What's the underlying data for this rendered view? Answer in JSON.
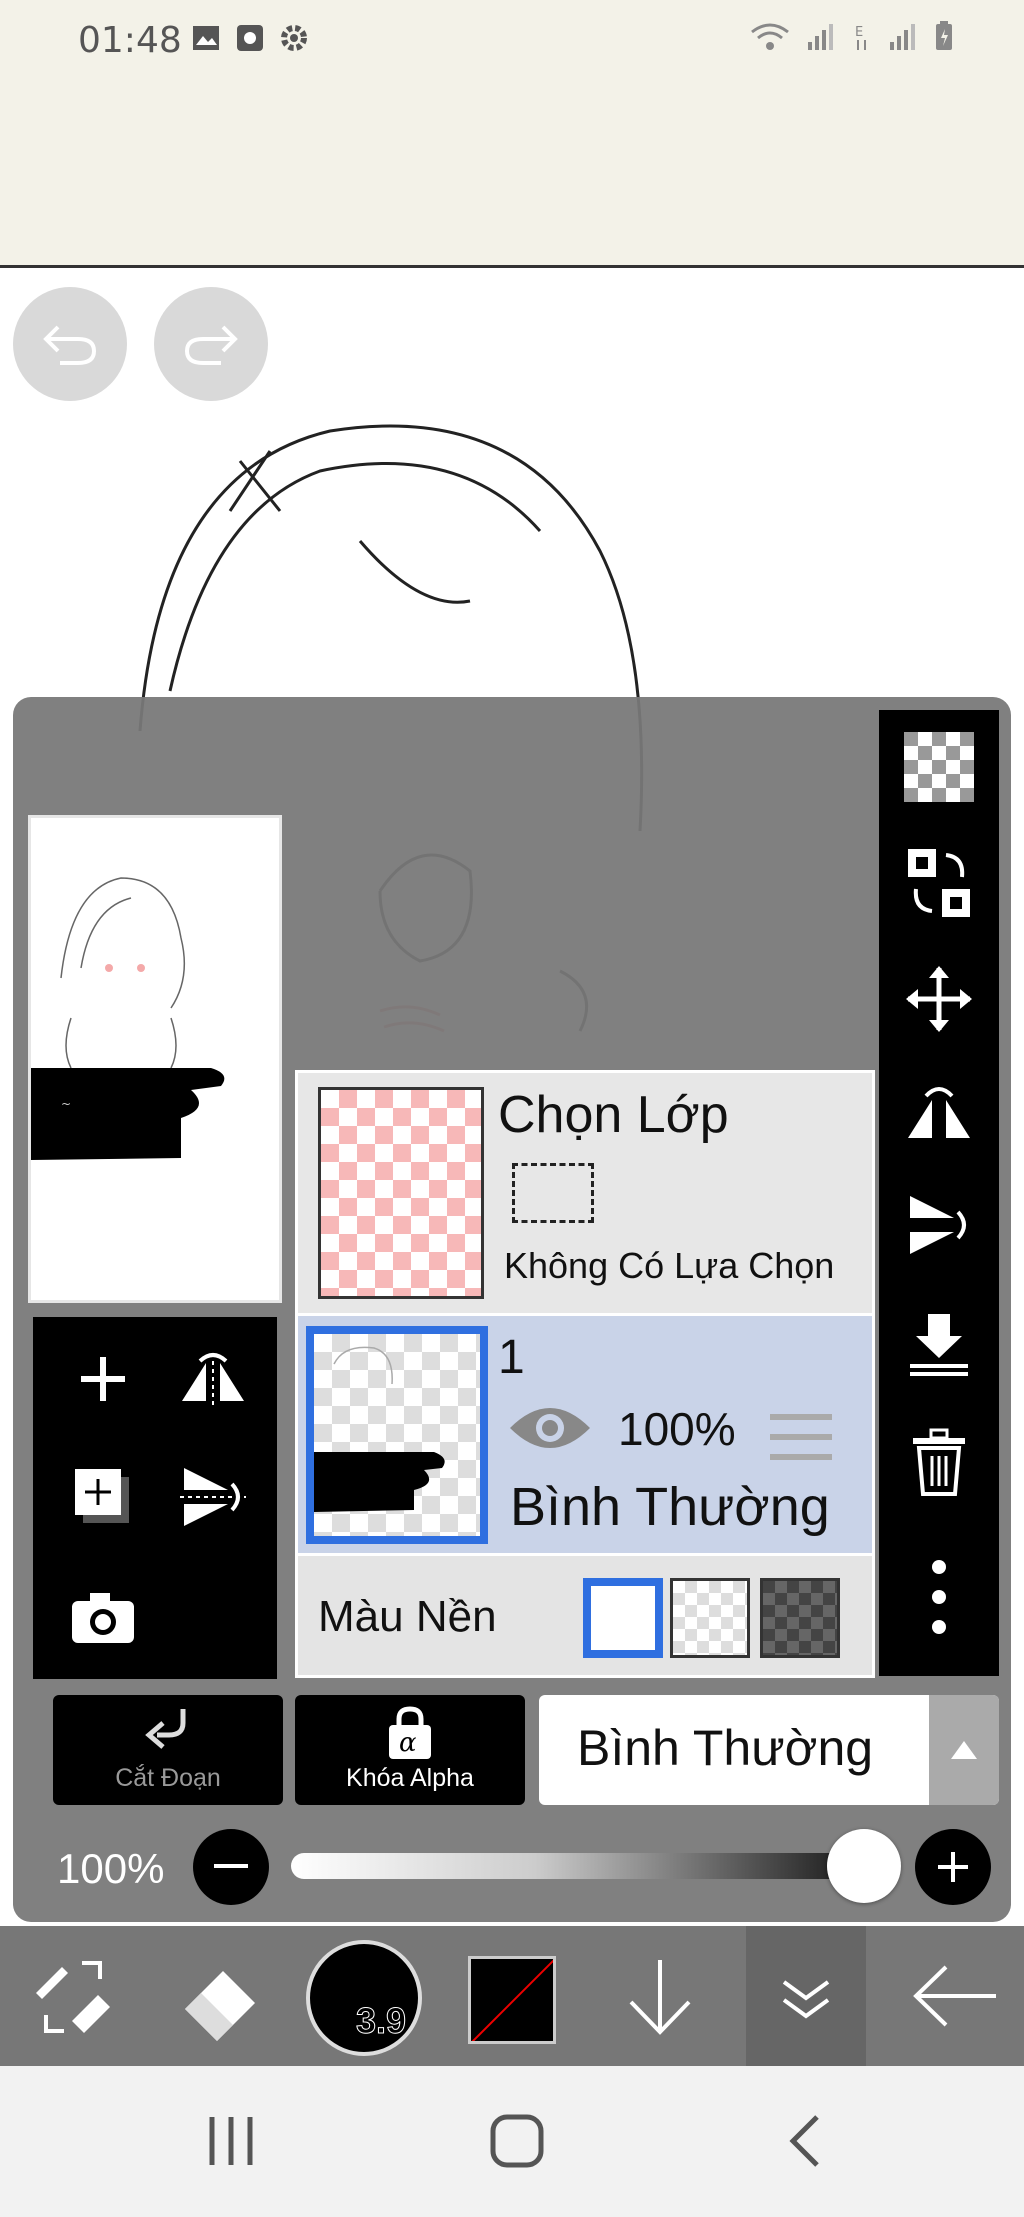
{
  "status_bar": {
    "time": "01:48",
    "left_icons": [
      "image-icon",
      "record-icon",
      "settings-icon"
    ],
    "right_icons": [
      "wifi-icon",
      "signal-icon",
      "data-e-icon",
      "signal-icon",
      "battery-icon"
    ]
  },
  "canvas": {
    "undo_icon": "undo-icon",
    "redo_icon": "redo-icon"
  },
  "layer_panel": {
    "selection_layer": {
      "title": "Chọn Lớp",
      "subtitle": "Không Có Lựa Chọn"
    },
    "layer": {
      "name": "1",
      "opacity": "100%",
      "blend_mode": "Bình Thường",
      "visible": true
    },
    "background": {
      "label": "Màu Nền",
      "options": [
        "white",
        "transparent",
        "dark"
      ],
      "selected": "white"
    },
    "clip_label": "Cắt Đoạn",
    "alpha_lock_label": "Khóa Alpha",
    "blend_select_value": "Bình Thường",
    "opacity_label": "100%",
    "opacity_value": 1.0
  },
  "toolbar": {
    "brush_size": "3.9",
    "colors": {
      "accent": "#2f6fe0",
      "panel": "#787878",
      "selected_row": "#c9d3e8"
    }
  }
}
